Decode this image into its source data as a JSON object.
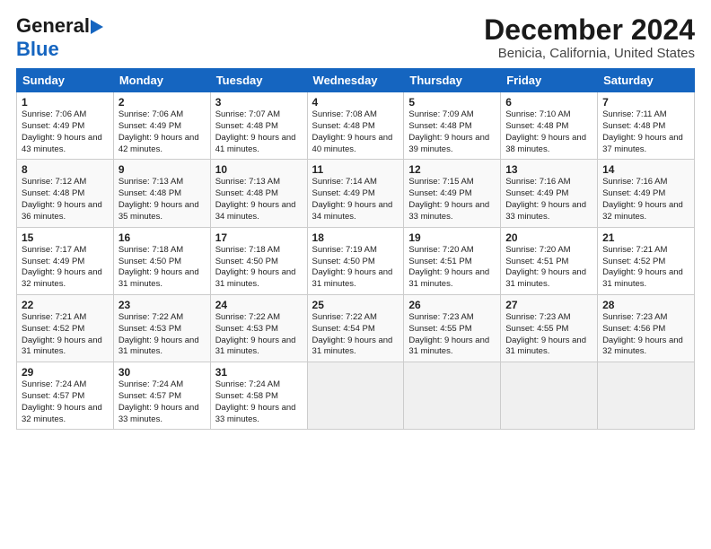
{
  "header": {
    "logo_general": "General",
    "logo_blue": "Blue",
    "title": "December 2024",
    "subtitle": "Benicia, California, United States"
  },
  "calendar": {
    "weekdays": [
      "Sunday",
      "Monday",
      "Tuesday",
      "Wednesday",
      "Thursday",
      "Friday",
      "Saturday"
    ],
    "weeks": [
      [
        {
          "day": "1",
          "sunrise": "7:06 AM",
          "sunset": "4:49 PM",
          "daylight": "9 hours and 43 minutes."
        },
        {
          "day": "2",
          "sunrise": "7:06 AM",
          "sunset": "4:49 PM",
          "daylight": "9 hours and 42 minutes."
        },
        {
          "day": "3",
          "sunrise": "7:07 AM",
          "sunset": "4:48 PM",
          "daylight": "9 hours and 41 minutes."
        },
        {
          "day": "4",
          "sunrise": "7:08 AM",
          "sunset": "4:48 PM",
          "daylight": "9 hours and 40 minutes."
        },
        {
          "day": "5",
          "sunrise": "7:09 AM",
          "sunset": "4:48 PM",
          "daylight": "9 hours and 39 minutes."
        },
        {
          "day": "6",
          "sunrise": "7:10 AM",
          "sunset": "4:48 PM",
          "daylight": "9 hours and 38 minutes."
        },
        {
          "day": "7",
          "sunrise": "7:11 AM",
          "sunset": "4:48 PM",
          "daylight": "9 hours and 37 minutes."
        }
      ],
      [
        {
          "day": "8",
          "sunrise": "7:12 AM",
          "sunset": "4:48 PM",
          "daylight": "9 hours and 36 minutes."
        },
        {
          "day": "9",
          "sunrise": "7:13 AM",
          "sunset": "4:48 PM",
          "daylight": "9 hours and 35 minutes."
        },
        {
          "day": "10",
          "sunrise": "7:13 AM",
          "sunset": "4:48 PM",
          "daylight": "9 hours and 34 minutes."
        },
        {
          "day": "11",
          "sunrise": "7:14 AM",
          "sunset": "4:49 PM",
          "daylight": "9 hours and 34 minutes."
        },
        {
          "day": "12",
          "sunrise": "7:15 AM",
          "sunset": "4:49 PM",
          "daylight": "9 hours and 33 minutes."
        },
        {
          "day": "13",
          "sunrise": "7:16 AM",
          "sunset": "4:49 PM",
          "daylight": "9 hours and 33 minutes."
        },
        {
          "day": "14",
          "sunrise": "7:16 AM",
          "sunset": "4:49 PM",
          "daylight": "9 hours and 32 minutes."
        }
      ],
      [
        {
          "day": "15",
          "sunrise": "7:17 AM",
          "sunset": "4:49 PM",
          "daylight": "9 hours and 32 minutes."
        },
        {
          "day": "16",
          "sunrise": "7:18 AM",
          "sunset": "4:50 PM",
          "daylight": "9 hours and 31 minutes."
        },
        {
          "day": "17",
          "sunrise": "7:18 AM",
          "sunset": "4:50 PM",
          "daylight": "9 hours and 31 minutes."
        },
        {
          "day": "18",
          "sunrise": "7:19 AM",
          "sunset": "4:50 PM",
          "daylight": "9 hours and 31 minutes."
        },
        {
          "day": "19",
          "sunrise": "7:20 AM",
          "sunset": "4:51 PM",
          "daylight": "9 hours and 31 minutes."
        },
        {
          "day": "20",
          "sunrise": "7:20 AM",
          "sunset": "4:51 PM",
          "daylight": "9 hours and 31 minutes."
        },
        {
          "day": "21",
          "sunrise": "7:21 AM",
          "sunset": "4:52 PM",
          "daylight": "9 hours and 31 minutes."
        }
      ],
      [
        {
          "day": "22",
          "sunrise": "7:21 AM",
          "sunset": "4:52 PM",
          "daylight": "9 hours and 31 minutes."
        },
        {
          "day": "23",
          "sunrise": "7:22 AM",
          "sunset": "4:53 PM",
          "daylight": "9 hours and 31 minutes."
        },
        {
          "day": "24",
          "sunrise": "7:22 AM",
          "sunset": "4:53 PM",
          "daylight": "9 hours and 31 minutes."
        },
        {
          "day": "25",
          "sunrise": "7:22 AM",
          "sunset": "4:54 PM",
          "daylight": "9 hours and 31 minutes."
        },
        {
          "day": "26",
          "sunrise": "7:23 AM",
          "sunset": "4:55 PM",
          "daylight": "9 hours and 31 minutes."
        },
        {
          "day": "27",
          "sunrise": "7:23 AM",
          "sunset": "4:55 PM",
          "daylight": "9 hours and 31 minutes."
        },
        {
          "day": "28",
          "sunrise": "7:23 AM",
          "sunset": "4:56 PM",
          "daylight": "9 hours and 32 minutes."
        }
      ],
      [
        {
          "day": "29",
          "sunrise": "7:24 AM",
          "sunset": "4:57 PM",
          "daylight": "9 hours and 32 minutes."
        },
        {
          "day": "30",
          "sunrise": "7:24 AM",
          "sunset": "4:57 PM",
          "daylight": "9 hours and 33 minutes."
        },
        {
          "day": "31",
          "sunrise": "7:24 AM",
          "sunset": "4:58 PM",
          "daylight": "9 hours and 33 minutes."
        },
        null,
        null,
        null,
        null
      ]
    ]
  }
}
